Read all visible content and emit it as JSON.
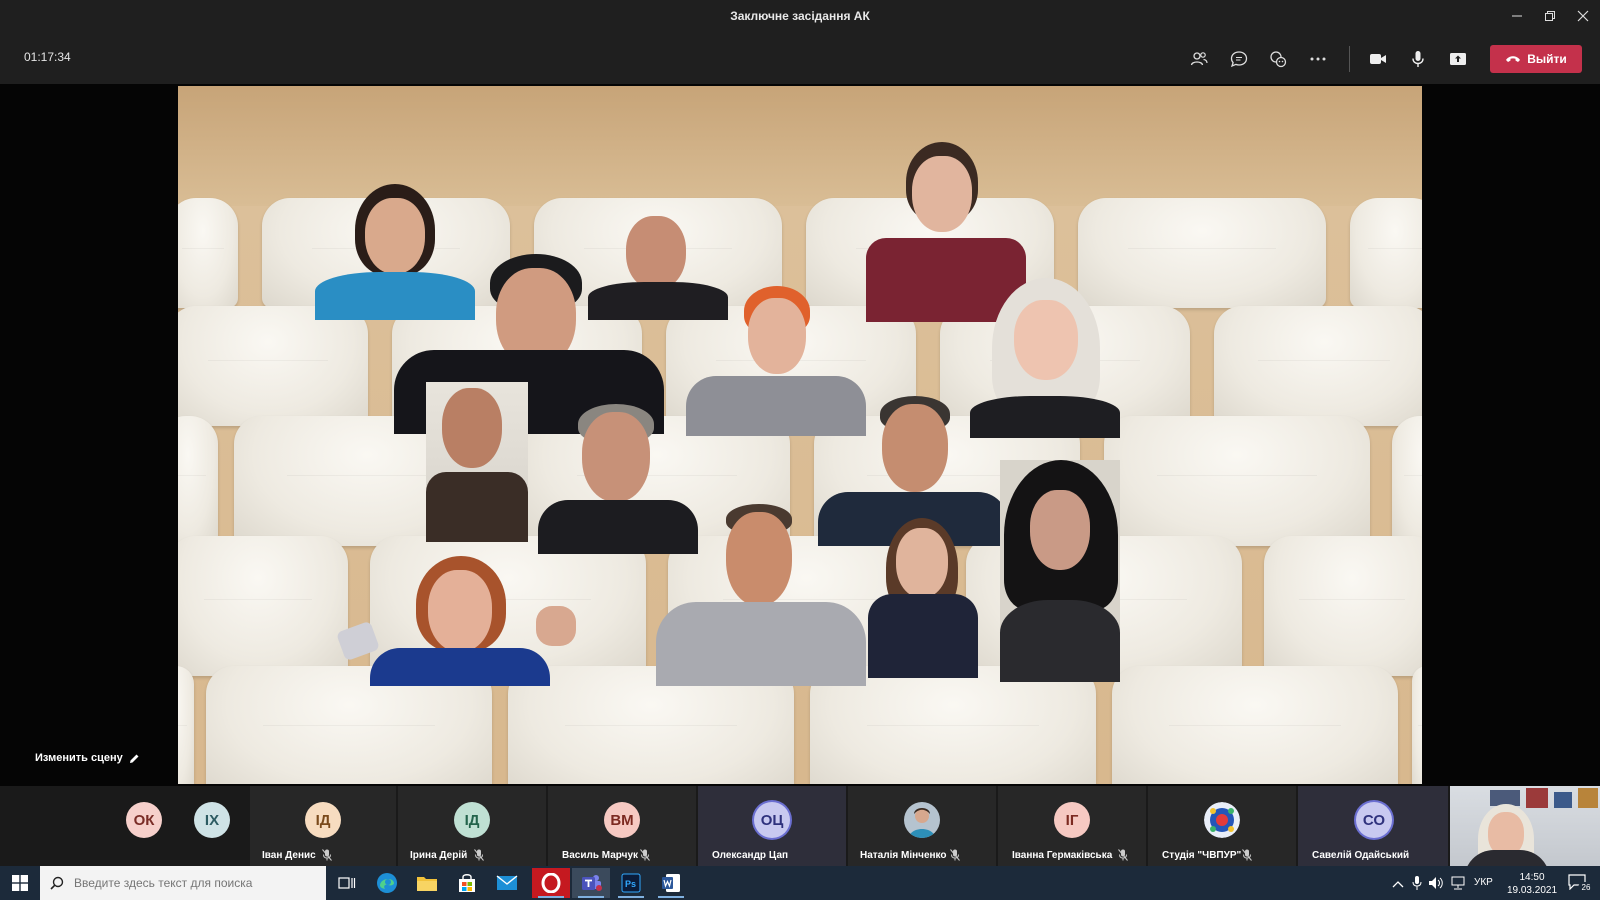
{
  "window": {
    "title": "Заключне засідання АК"
  },
  "toolbar": {
    "timer": "01:17:34",
    "leave_label": "Выйти",
    "leave_color": "#c4314b"
  },
  "stage": {
    "change_scene_label": "Изменить сцену"
  },
  "participants": [
    {
      "initials": "ОК",
      "name": "",
      "avatar_bg": "#f6d0cb",
      "avatar_fg": "#7a2d27",
      "muted": false
    },
    {
      "initials": "ІХ",
      "name": "",
      "avatar_bg": "#cfe3e6",
      "avatar_fg": "#2c5b62",
      "muted": false
    },
    {
      "initials": "ІД",
      "name": "Іван Денис",
      "avatar_bg": "#f7dcc0",
      "avatar_fg": "#7a4a1c",
      "muted": true
    },
    {
      "initials": "ІД",
      "name": "Ірина Дерій",
      "avatar_bg": "#bfe0d3",
      "avatar_fg": "#22634b",
      "muted": true
    },
    {
      "initials": "ВМ",
      "name": "Василь Марчук",
      "avatar_bg": "#f6c9c2",
      "avatar_fg": "#7c2a21",
      "muted": true
    },
    {
      "initials": "ОЦ",
      "name": "Олександр Цап",
      "avatar_bg": "#c8c9f0",
      "avatar_fg": "#2f327d",
      "muted": false
    },
    {
      "initials": "",
      "name": "Наталія Мінченко",
      "avatar_bg": "#9aa8b6",
      "avatar_fg": "#fff",
      "muted": true
    },
    {
      "initials": "ІГ",
      "name": "Іванна Гермаківська",
      "avatar_bg": "#f6c9c2",
      "avatar_fg": "#7c2a21",
      "muted": true
    },
    {
      "initials": "",
      "name": "Студія \"ЧВПУР\"",
      "avatar_bg": "#e8eef8",
      "avatar_fg": "#1f4aa0",
      "muted": true
    },
    {
      "initials": "СО",
      "name": "Савелій Одайський",
      "avatar_bg": "#c8c9f0",
      "avatar_fg": "#2f327d",
      "muted": false
    }
  ],
  "taskbar": {
    "search_placeholder": "Введите здесь текст для поиска",
    "language": "УКР",
    "time": "14:50",
    "date": "19.03.2021",
    "notifications_count": "26"
  }
}
